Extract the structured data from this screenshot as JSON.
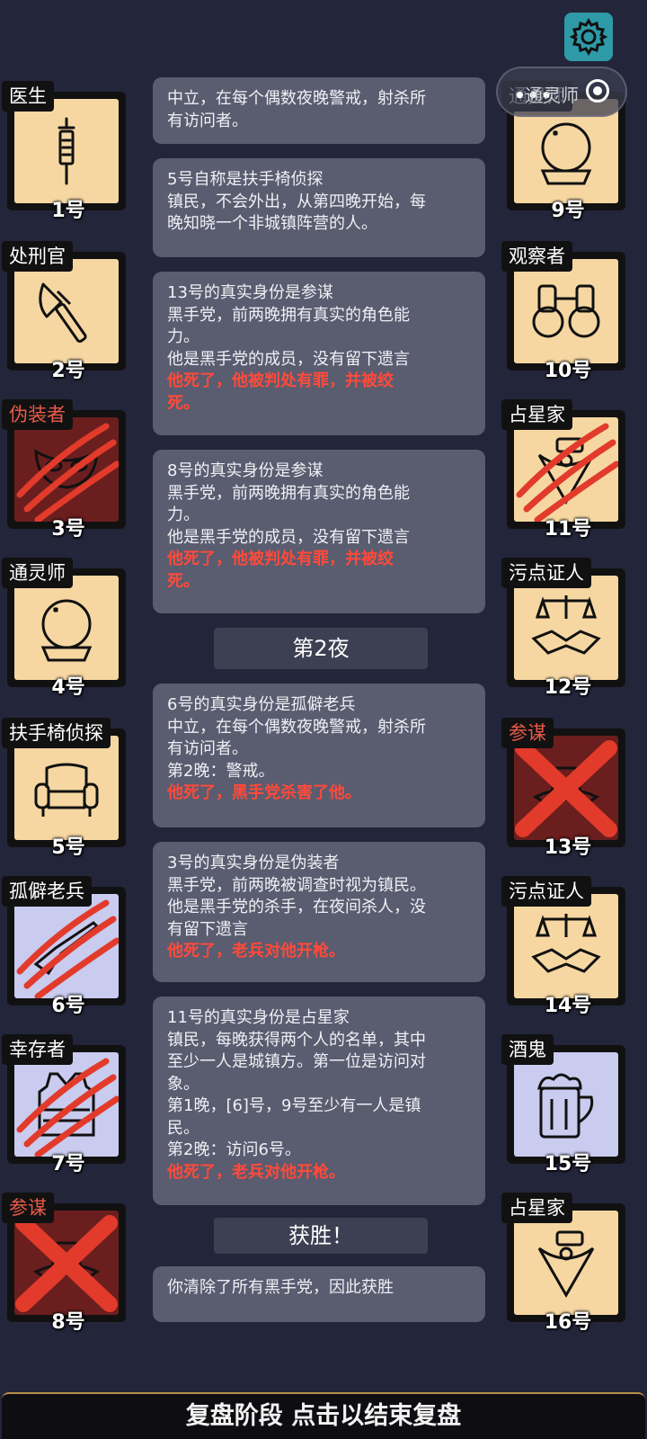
{
  "players": [
    {
      "num": "1号",
      "role": "医生",
      "status": "alive",
      "role_evil": false,
      "icon": "syringe-icon"
    },
    {
      "num": "2号",
      "role": "处刑官",
      "status": "alive",
      "role_evil": false,
      "icon": "axe-icon"
    },
    {
      "num": "3号",
      "role": "伪装者",
      "status": "dead-claw",
      "role_evil": true,
      "icon": "mask-icon"
    },
    {
      "num": "4号",
      "role": "通灵师",
      "status": "alive",
      "role_evil": false,
      "icon": "crystal-ball-icon"
    },
    {
      "num": "5号",
      "role": "扶手椅侦探",
      "status": "alive",
      "role_evil": false,
      "icon": "armchair-icon"
    },
    {
      "num": "6号",
      "role": "孤僻老兵",
      "status": "dead-claw",
      "role_evil": false,
      "icon": "rifle-icon"
    },
    {
      "num": "7号",
      "role": "幸存者",
      "status": "dead-claw",
      "role_evil": false,
      "icon": "vest-icon"
    },
    {
      "num": "8号",
      "role": "参谋",
      "status": "dead-x",
      "role_evil": true,
      "icon": "hat-icon"
    },
    {
      "num": "9号",
      "role": "通灵师",
      "status": "alive",
      "role_evil": false,
      "icon": "crystal-ball-icon"
    },
    {
      "num": "10号",
      "role": "观察者",
      "status": "alive",
      "role_evil": false,
      "icon": "binoculars-icon"
    },
    {
      "num": "11号",
      "role": "占星家",
      "status": "dead-claw",
      "role_evil": false,
      "icon": "sextant-icon"
    },
    {
      "num": "12号",
      "role": "污点证人",
      "status": "alive",
      "role_evil": false,
      "icon": "scales-handshake-icon"
    },
    {
      "num": "13号",
      "role": "参谋",
      "status": "dead-x",
      "role_evil": true,
      "icon": "hat-icon"
    },
    {
      "num": "14号",
      "role": "污点证人",
      "status": "alive",
      "role_evil": false,
      "icon": "scales-handshake-icon"
    },
    {
      "num": "15号",
      "role": "酒鬼",
      "status": "alive",
      "role_evil": false,
      "icon": "beer-mug-icon"
    },
    {
      "num": "16号",
      "role": "占星家",
      "status": "alive",
      "role_evil": false,
      "icon": "sextant-icon"
    }
  ],
  "log": {
    "m0": {
      "lines": [
        "中立，在每个偶数夜晚警戒，射杀所",
        "有访问者。"
      ]
    },
    "m1": {
      "lines": [
        "5号自称是扶手椅侦探",
        "镇民，不会外出，从第四晚开始，每",
        "晚知晓一个非城镇阵营的人。"
      ]
    },
    "m2": {
      "lines": [
        "13号的真实身份是参谋",
        "黑手党，前两晚拥有真实的角色能",
        "力。",
        "他是黑手党的成员，没有留下遗言"
      ],
      "death": [
        "他死了，他被判处有罪，并被绞",
        "死。"
      ]
    },
    "m3": {
      "lines": [
        "8号的真实身份是参谋",
        "黑手党，前两晚拥有真实的角色能",
        "力。",
        "他是黑手党的成员，没有留下遗言"
      ],
      "death": [
        "他死了，他被判处有罪，并被绞",
        "死。"
      ]
    },
    "night2": "第2夜",
    "m4": {
      "lines": [
        "6号的真实身份是孤僻老兵",
        "中立，在每个偶数夜晚警戒，射杀所",
        "有访问者。",
        "第2晚：警戒。"
      ],
      "death": [
        "他死了，黑手党杀害了他。"
      ]
    },
    "m5": {
      "lines": [
        "3号的真实身份是伪装者",
        "黑手党，前两晚被调查时视为镇民。",
        "他是黑手党的杀手，在夜间杀人，没",
        "有留下遗言"
      ],
      "death": [
        "他死了，老兵对他开枪。"
      ]
    },
    "m6": {
      "lines": [
        "11号的真实身份是占星家",
        "镇民，每晚获得两个人的名单，其中",
        "至少一人是城镇方。第一位是访问对",
        "象。",
        "第1晚，[6]号，9号至少有一人是镇",
        "民。",
        "第2晚：访问6号。"
      ],
      "death": [
        "他死了，老兵对他开枪。"
      ]
    },
    "victory": "获胜！",
    "m7": {
      "lines": [
        "你清除了所有黑手党，因此获胜"
      ]
    }
  },
  "capsule_text": "通灵师",
  "bottom_bar": "复盘阶段 点击以结束复盘",
  "colors": {
    "background": "#23253a",
    "card_alive": "#f6d7a2",
    "card_dead": "#6b1e1e",
    "card_alt": "#c9cbef",
    "death_text": "#ff4a3a",
    "gear_bg": "#2e9aa8"
  }
}
